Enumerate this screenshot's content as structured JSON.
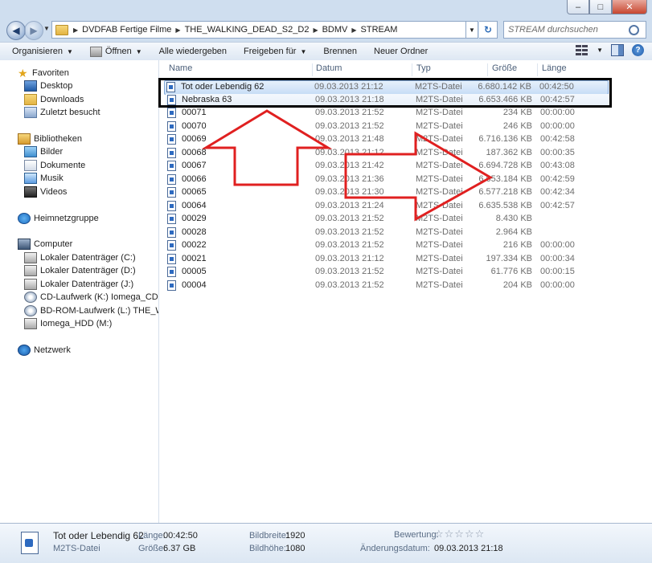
{
  "caption": {
    "minimize": "–",
    "maximize": "□",
    "close": "✕"
  },
  "address": {
    "crumbs": [
      "DVDFAB Fertige Filme",
      "THE_WALKING_DEAD_S2_D2",
      "BDMV",
      "STREAM"
    ],
    "search_placeholder": "STREAM durchsuchen"
  },
  "toolbar": {
    "organize": "Organisieren",
    "open": "Öffnen",
    "play_all": "Alle wiedergeben",
    "share": "Freigeben für",
    "burn": "Brennen",
    "new_folder": "Neuer Ordner"
  },
  "nav": {
    "favorites": "Favoriten",
    "desktop": "Desktop",
    "downloads": "Downloads",
    "recent": "Zuletzt besucht",
    "libraries": "Bibliotheken",
    "pictures": "Bilder",
    "documents": "Dokumente",
    "music": "Musik",
    "videos": "Videos",
    "homegroup": "Heimnetzgruppe",
    "computer": "Computer",
    "drive_c": "Lokaler Datenträger (C:)",
    "drive_d": "Lokaler Datenträger (D:)",
    "drive_j": "Lokaler Datenträger (J:)",
    "drive_k": "CD-Laufwerk (K:) Iomega_CD",
    "drive_l": "BD-ROM-Laufwerk (L:) THE_WALKIN",
    "drive_m": "Iomega_HDD (M:)",
    "network": "Netzwerk"
  },
  "columns": {
    "name": "Name",
    "date": "Datum",
    "type": "Typ",
    "size": "Größe",
    "length": "Länge"
  },
  "files": [
    {
      "name": "Tot oder Lebendig 62",
      "date": "09.03.2013 21:12",
      "type": "M2TS-Datei",
      "size": "6.680.142 KB",
      "length": "00:42:50"
    },
    {
      "name": "Nebraska 63",
      "date": "09.03.2013 21:18",
      "type": "M2TS-Datei",
      "size": "6.653.466 KB",
      "length": "00:42:57"
    },
    {
      "name": "00071",
      "date": "09.03.2013 21:52",
      "type": "M2TS-Datei",
      "size": "234 KB",
      "length": "00:00:00"
    },
    {
      "name": "00070",
      "date": "09.03.2013 21:52",
      "type": "M2TS-Datei",
      "size": "246 KB",
      "length": "00:00:00"
    },
    {
      "name": "00069",
      "date": "09.03.2013 21:48",
      "type": "M2TS-Datei",
      "size": "6.716.136 KB",
      "length": "00:42:58"
    },
    {
      "name": "00068",
      "date": "09.03.2013 21:12",
      "type": "M2TS-Datei",
      "size": "187.362 KB",
      "length": "00:00:35"
    },
    {
      "name": "00067",
      "date": "09.03.2013 21:42",
      "type": "M2TS-Datei",
      "size": "6.694.728 KB",
      "length": "00:43:08"
    },
    {
      "name": "00066",
      "date": "09.03.2013 21:36",
      "type": "M2TS-Datei",
      "size": "6.653.184 KB",
      "length": "00:42:59"
    },
    {
      "name": "00065",
      "date": "09.03.2013 21:30",
      "type": "M2TS-Datei",
      "size": "6.577.218 KB",
      "length": "00:42:34"
    },
    {
      "name": "00064",
      "date": "09.03.2013 21:24",
      "type": "M2TS-Datei",
      "size": "6.635.538 KB",
      "length": "00:42:57"
    },
    {
      "name": "00029",
      "date": "09.03.2013 21:52",
      "type": "M2TS-Datei",
      "size": "8.430 KB",
      "length": ""
    },
    {
      "name": "00028",
      "date": "09.03.2013 21:52",
      "type": "M2TS-Datei",
      "size": "2.964 KB",
      "length": ""
    },
    {
      "name": "00022",
      "date": "09.03.2013 21:52",
      "type": "M2TS-Datei",
      "size": "216 KB",
      "length": "00:00:00"
    },
    {
      "name": "00021",
      "date": "09.03.2013 21:12",
      "type": "M2TS-Datei",
      "size": "197.334 KB",
      "length": "00:00:34"
    },
    {
      "name": "00005",
      "date": "09.03.2013 21:52",
      "type": "M2TS-Datei",
      "size": "61.776 KB",
      "length": "00:00:15"
    },
    {
      "name": "00004",
      "date": "09.03.2013 21:52",
      "type": "M2TS-Datei",
      "size": "204 KB",
      "length": "00:00:00"
    }
  ],
  "details": {
    "name": "Tot oder Lebendig 62",
    "type": "M2TS-Datei",
    "length_label": "Länge:",
    "length_value": "00:42:50",
    "size_label": "Größe:",
    "size_value": "6.37 GB",
    "width_label": "Bildbreite:",
    "width_value": "1920",
    "height_label": "Bildhöhe:",
    "height_value": "1080",
    "rating_label": "Bewertung:",
    "rating_stars": "☆☆☆☆☆",
    "modified_label": "Änderungsdatum:",
    "modified_value": "09.03.2013 21:18"
  },
  "colors": {
    "annotation_arrow": "#e02020",
    "selection": "#c7ddf6"
  }
}
